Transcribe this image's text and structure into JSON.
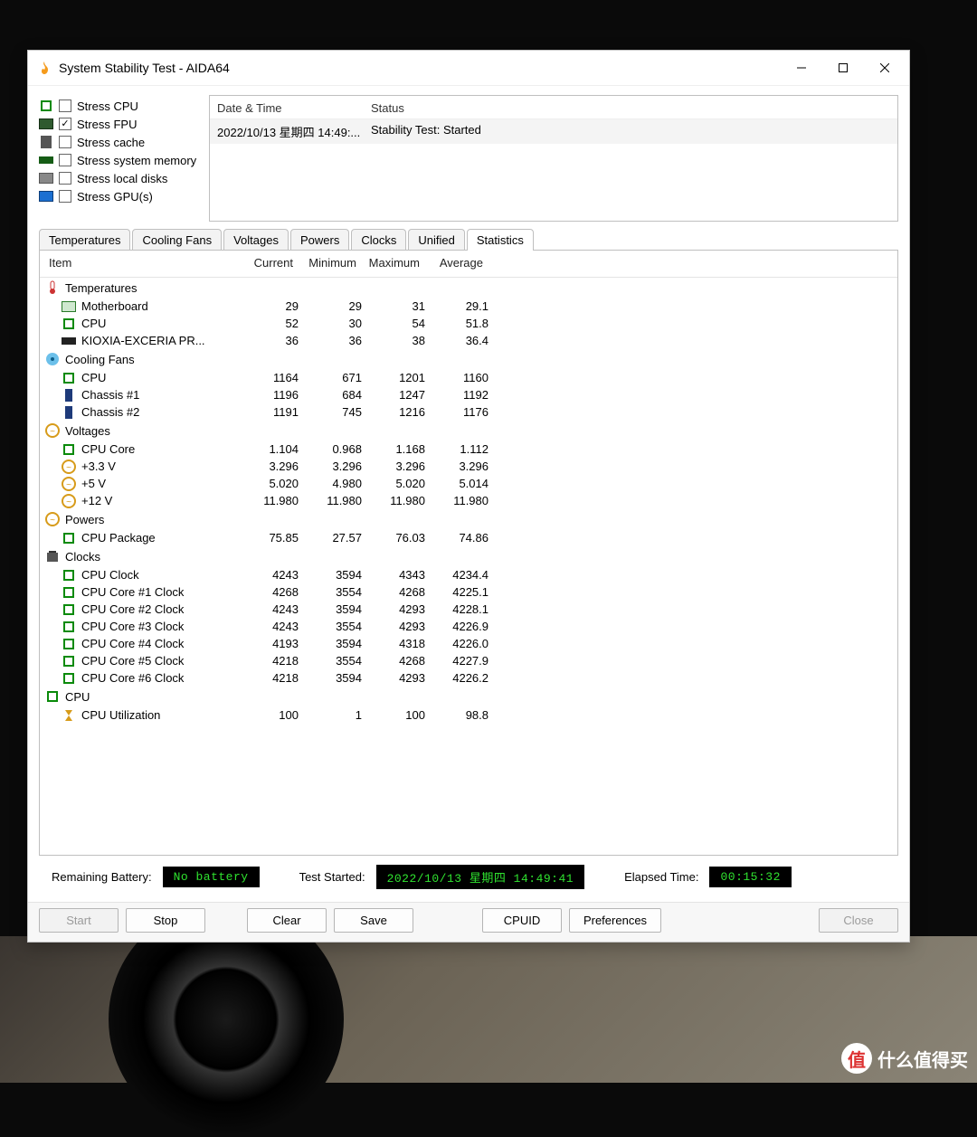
{
  "window": {
    "title": "System Stability Test - AIDA64"
  },
  "stress": {
    "cpu": {
      "label": "Stress CPU",
      "checked": false
    },
    "fpu": {
      "label": "Stress FPU",
      "checked": true
    },
    "cache": {
      "label": "Stress cache",
      "checked": false
    },
    "mem": {
      "label": "Stress system memory",
      "checked": false
    },
    "disk": {
      "label": "Stress local disks",
      "checked": false
    },
    "gpu": {
      "label": "Stress GPU(s)",
      "checked": false
    }
  },
  "log": {
    "head_date": "Date & Time",
    "head_status": "Status",
    "row_date": "2022/10/13 星期四 14:49:...",
    "row_status": "Stability Test: Started"
  },
  "tabs": [
    "Temperatures",
    "Cooling Fans",
    "Voltages",
    "Powers",
    "Clocks",
    "Unified",
    "Statistics"
  ],
  "grid": {
    "head": {
      "item": "Item",
      "cur": "Current",
      "min": "Minimum",
      "max": "Maximum",
      "avg": "Average"
    },
    "groups": {
      "temperatures": "Temperatures",
      "fans": "Cooling Fans",
      "voltages": "Voltages",
      "powers": "Powers",
      "clocks": "Clocks",
      "cpu": "CPU"
    }
  },
  "rows": {
    "mb": {
      "label": "Motherboard",
      "cur": "29",
      "min": "29",
      "max": "31",
      "avg": "29.1"
    },
    "cpu_t": {
      "label": "CPU",
      "cur": "52",
      "min": "30",
      "max": "54",
      "avg": "51.8"
    },
    "ssd": {
      "label": "KIOXIA-EXCERIA PR...",
      "cur": "36",
      "min": "36",
      "max": "38",
      "avg": "36.4"
    },
    "fan_cpu": {
      "label": "CPU",
      "cur": "1164",
      "min": "671",
      "max": "1201",
      "avg": "1160"
    },
    "ch1": {
      "label": "Chassis #1",
      "cur": "1196",
      "min": "684",
      "max": "1247",
      "avg": "1192"
    },
    "ch2": {
      "label": "Chassis #2",
      "cur": "1191",
      "min": "745",
      "max": "1216",
      "avg": "1176"
    },
    "vcore": {
      "label": "CPU Core",
      "cur": "1.104",
      "min": "0.968",
      "max": "1.168",
      "avg": "1.112"
    },
    "v33": {
      "label": "+3.3 V",
      "cur": "3.296",
      "min": "3.296",
      "max": "3.296",
      "avg": "3.296"
    },
    "v5": {
      "label": "+5 V",
      "cur": "5.020",
      "min": "4.980",
      "max": "5.020",
      "avg": "5.014"
    },
    "v12": {
      "label": "+12 V",
      "cur": "11.980",
      "min": "11.980",
      "max": "11.980",
      "avg": "11.980"
    },
    "pkg": {
      "label": "CPU Package",
      "cur": "75.85",
      "min": "27.57",
      "max": "76.03",
      "avg": "74.86"
    },
    "clk": {
      "label": "CPU Clock",
      "cur": "4243",
      "min": "3594",
      "max": "4343",
      "avg": "4234.4"
    },
    "c1": {
      "label": "CPU Core #1 Clock",
      "cur": "4268",
      "min": "3554",
      "max": "4268",
      "avg": "4225.1"
    },
    "c2": {
      "label": "CPU Core #2 Clock",
      "cur": "4243",
      "min": "3594",
      "max": "4293",
      "avg": "4228.1"
    },
    "c3": {
      "label": "CPU Core #3 Clock",
      "cur": "4243",
      "min": "3554",
      "max": "4293",
      "avg": "4226.9"
    },
    "c4": {
      "label": "CPU Core #4 Clock",
      "cur": "4193",
      "min": "3594",
      "max": "4318",
      "avg": "4226.0"
    },
    "c5": {
      "label": "CPU Core #5 Clock",
      "cur": "4218",
      "min": "3554",
      "max": "4268",
      "avg": "4227.9"
    },
    "c6": {
      "label": "CPU Core #6 Clock",
      "cur": "4218",
      "min": "3594",
      "max": "4293",
      "avg": "4226.2"
    },
    "util": {
      "label": "CPU Utilization",
      "cur": "100",
      "min": "1",
      "max": "100",
      "avg": "98.8"
    }
  },
  "status": {
    "battery_label": "Remaining Battery:",
    "battery_value": "No battery",
    "started_label": "Test Started:",
    "started_value": "2022/10/13 星期四 14:49:41",
    "elapsed_label": "Elapsed Time:",
    "elapsed_value": "00:15:32"
  },
  "buttons": {
    "start": "Start",
    "stop": "Stop",
    "clear": "Clear",
    "save": "Save",
    "cpuid": "CPUID",
    "prefs": "Preferences",
    "close": "Close"
  },
  "watermark": "什么值得买"
}
